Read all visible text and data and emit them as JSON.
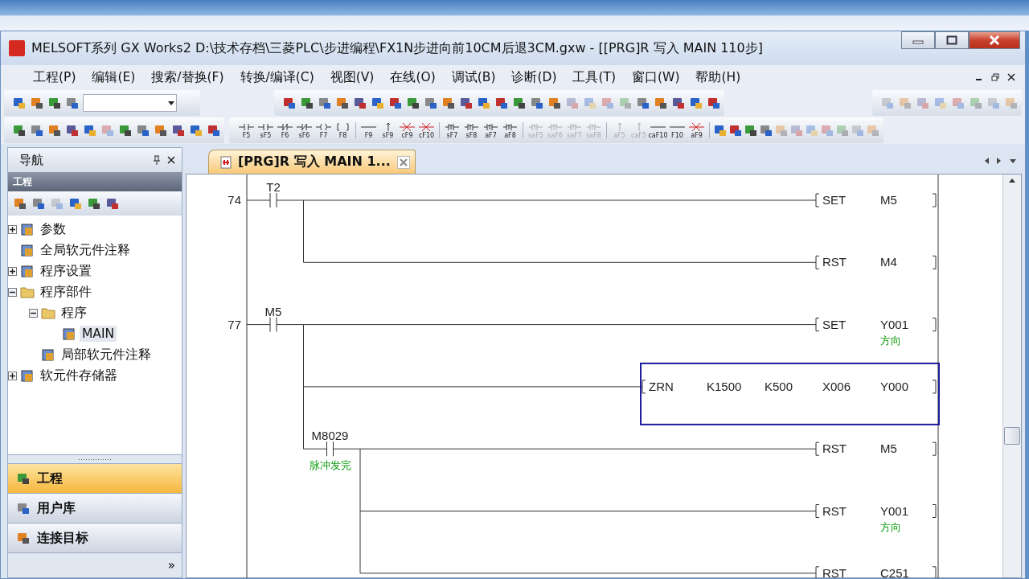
{
  "window": {
    "title": "MELSOFT系列 GX Works2 D:\\技术存档\\三菱PLC\\步进编程\\FX1N步进向前10CM后退3CM.gxw - [[PRG]R 写入 MAIN 110步]"
  },
  "menu": [
    "工程(P)",
    "编辑(E)",
    "搜索/替换(F)",
    "转换/编译(C)",
    "视图(V)",
    "在线(O)",
    "调试(B)",
    "诊断(D)",
    "工具(T)",
    "窗口(W)",
    "帮助(H)"
  ],
  "key_groups": [
    [
      {
        "label": "F5",
        "kind": "contact",
        "disabled": false
      },
      {
        "label": "sF5",
        "kind": "contact",
        "disabled": false
      },
      {
        "label": "F6",
        "kind": "closed",
        "disabled": false
      },
      {
        "label": "sF6",
        "kind": "closed",
        "disabled": false
      },
      {
        "label": "F7",
        "kind": "coil",
        "disabled": false
      },
      {
        "label": "F8",
        "kind": "func",
        "disabled": false
      }
    ],
    [
      {
        "label": "F9",
        "kind": "hline",
        "disabled": false
      },
      {
        "label": "sF9",
        "kind": "vline",
        "disabled": false
      },
      {
        "label": "cF9",
        "kind": "delete",
        "disabled": false
      },
      {
        "label": "cF10",
        "kind": "delete",
        "disabled": false
      }
    ],
    [
      {
        "label": "sF7",
        "kind": "pulse",
        "disabled": false
      },
      {
        "label": "sF8",
        "kind": "pulse",
        "disabled": false
      },
      {
        "label": "aF7",
        "kind": "pulse",
        "disabled": false
      },
      {
        "label": "aF8",
        "kind": "pulse",
        "disabled": false
      }
    ],
    [
      {
        "label": "saF5",
        "kind": "pulse",
        "disabled": true
      },
      {
        "label": "saF6",
        "kind": "pulse",
        "disabled": true
      },
      {
        "label": "saF7",
        "kind": "pulse",
        "disabled": true
      },
      {
        "label": "saF8",
        "kind": "pulse",
        "disabled": true
      }
    ],
    [
      {
        "label": "aF5",
        "kind": "vline",
        "disabled": true
      },
      {
        "label": "caF5",
        "kind": "vline",
        "disabled": true
      },
      {
        "label": "caF10",
        "kind": "hline",
        "disabled": false
      },
      {
        "label": "F10",
        "kind": "hline",
        "disabled": false
      },
      {
        "label": "aF9",
        "kind": "delete",
        "disabled": false
      }
    ]
  ],
  "navigation": {
    "title": "导航",
    "section": "工程",
    "tree": [
      {
        "label": "参数",
        "expanded": false,
        "selected": false
      },
      {
        "label": "全局软元件注释",
        "selected": false
      },
      {
        "label": "程序设置",
        "expanded": false,
        "selected": false
      },
      {
        "label": "程序部件",
        "expanded": true,
        "selected": false,
        "children": [
          {
            "label": "程序",
            "expanded": true,
            "selected": false,
            "children": [
              {
                "label": "MAIN",
                "selected": true
              }
            ]
          },
          {
            "label": "局部软元件注释",
            "selected": false
          }
        ]
      },
      {
        "label": "软元件存储器",
        "expanded": false,
        "selected": false
      }
    ],
    "views": [
      {
        "label": "工程",
        "selected": true
      },
      {
        "label": "用户库",
        "selected": false
      },
      {
        "label": "连接目标",
        "selected": false
      }
    ],
    "more": "»"
  },
  "editor": {
    "tab": {
      "label": "[PRG]R 写入 MAIN 1...",
      "selected": true
    },
    "rungs": [
      {
        "step": "74",
        "contact": {
          "label": "T2"
        },
        "outputs": [
          {
            "instruction": [
              "SET",
              "M5"
            ],
            "selected": false
          },
          {
            "instruction": [
              "RST",
              "M4"
            ],
            "selected": false
          }
        ]
      },
      {
        "step": "77",
        "contact": {
          "label": "M5"
        },
        "outputs": [
          {
            "instruction": [
              "SET",
              "Y001"
            ],
            "comment": "方向",
            "selected": false
          },
          {
            "instruction": [
              "ZRN",
              "K1500",
              "K500",
              "X006",
              "Y000"
            ],
            "selected": true
          },
          {
            "contact": {
              "label": "M8029",
              "comment": "脉冲发完"
            },
            "outputs": [
              {
                "instruction": [
                  "RST",
                  "M5"
                ],
                "selected": false
              },
              {
                "instruction": [
                  "RST",
                  "Y001"
                ],
                "comment": "方向",
                "selected": false
              },
              {
                "instruction": [
                  "RST",
                  "C251"
                ],
                "selected": false
              }
            ]
          }
        ]
      }
    ]
  }
}
